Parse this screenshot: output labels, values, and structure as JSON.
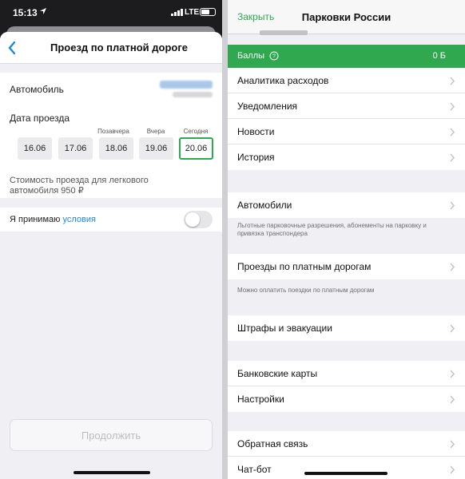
{
  "status_bar": {
    "time": "15:13",
    "network": "LTE"
  },
  "left": {
    "title": "Проезд по платной дороге",
    "car_label": "Автомобиль",
    "date_label": "Дата проезда",
    "day_labels": [
      "Позавчера",
      "Вчера",
      "Сегодня"
    ],
    "dates": [
      "16.06",
      "17.06",
      "18.06",
      "19.06",
      "20.06"
    ],
    "selected_date": "20.06",
    "cost_text": "Стоимость проезда для легкового автомобиля 950 ₽",
    "accept_text": "Я принимаю ",
    "accept_link": "условия",
    "continue_label": "Продолжить"
  },
  "right": {
    "close_label": "Закрыть",
    "title": "Парковки России",
    "balls_label": "Баллы",
    "balls_value": "0 Б",
    "group1": [
      "Аналитика расходов",
      "Уведомления",
      "Новости",
      "История"
    ],
    "cars_label": "Автомобили",
    "cars_hint": "Льготные парковочные разрешения, абонементы на парковку и привязка транспондера",
    "toll_label": "Проезды по платным дорогам",
    "toll_hint": "Можно оплатить поездки по платным дорогам",
    "fines_label": "Штрафы и эвакуации",
    "group4": [
      "Банковские карты",
      "Настройки"
    ],
    "group5": [
      "Обратная связь",
      "Чат-бот"
    ]
  },
  "colors": {
    "accent_green": "#2fa84f",
    "link_blue": "#1e88d3"
  }
}
